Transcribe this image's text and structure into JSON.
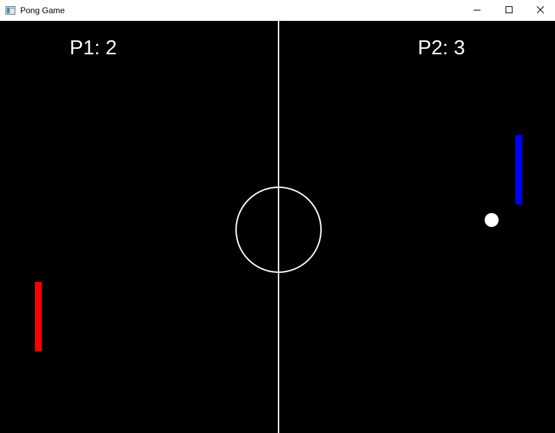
{
  "window": {
    "title": "Pong Game"
  },
  "titlebar_icons": {
    "app": "window-app-icon",
    "minimize": "minimize-icon",
    "maximize": "maximize-icon",
    "close": "close-icon"
  },
  "scoreboard": {
    "player1": "P1: 2",
    "player2": "P2: 3"
  },
  "colors": {
    "background": "#000000",
    "lines": "#ffffff",
    "score_text": "#ffffff",
    "left_paddle": "#ff0000",
    "right_paddle": "#0000ff",
    "ball": "#ffffff"
  }
}
